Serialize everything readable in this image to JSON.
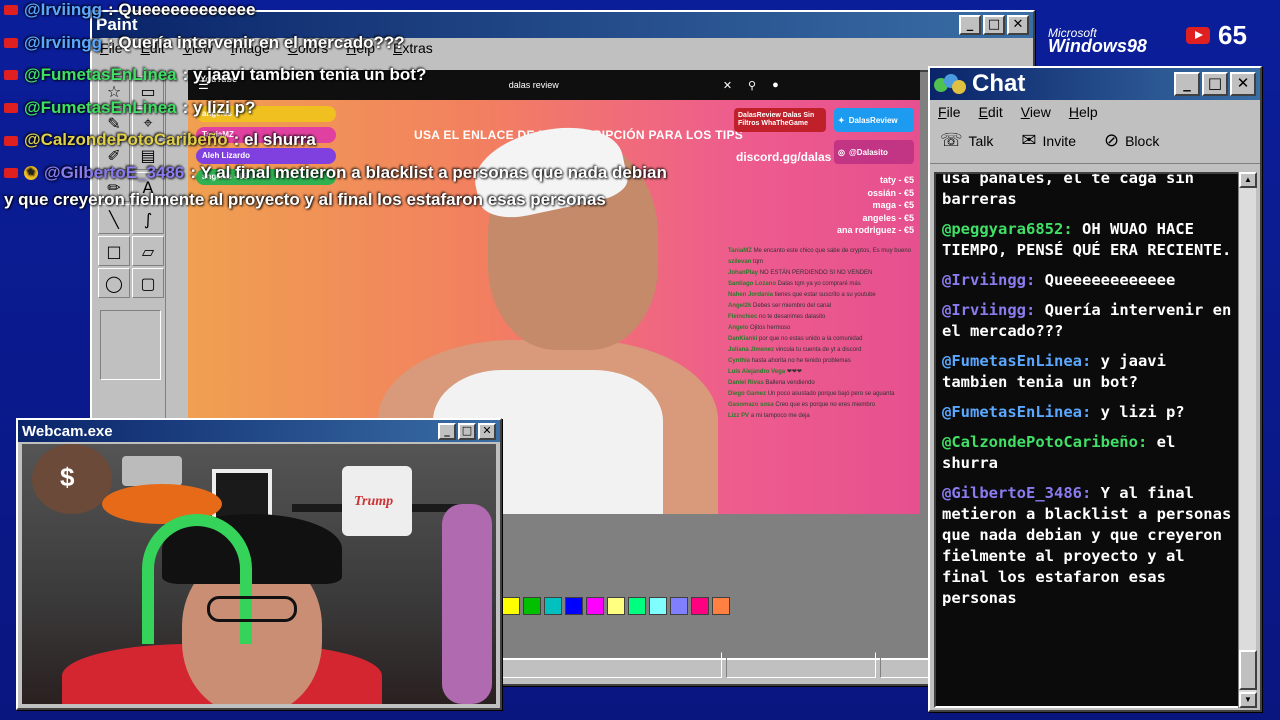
{
  "paint": {
    "title": "Paint",
    "menu": [
      "File",
      "Edit",
      "View",
      "Image",
      "Colors",
      "Help",
      "Extras"
    ],
    "tools": [
      "☆",
      "▭",
      "✎",
      "⌖",
      "✐",
      "▤",
      "✏",
      "A",
      "╲",
      "∫",
      "□",
      "▱",
      "◯",
      "▢"
    ],
    "palette": [
      "#ffff00",
      "#00c000",
      "#00c0c0",
      "#0000ff",
      "#ff00ff",
      "#ffff80",
      "#00ff80",
      "#80ffff",
      "#8080ff",
      "#ff0080",
      "#ff8040"
    ]
  },
  "youtube": {
    "search_text": "dalas review",
    "logo": "YouTube",
    "banner": "USA EL ENLACE DE LA DESCRIPCIÓN PARA LOS TIPS",
    "discord": "discord.gg/dalas",
    "social_youtube": "DalasReview Dalas Sin Filtros WhaTheGame",
    "social_twitter": "DalasReview",
    "social_instagram": "@Dalasito",
    "tips": [
      "taty - €5",
      "ossián - €5",
      "maga - €5",
      "angeles - €5",
      "ana rodriguez - €5"
    ],
    "goals": [
      "angeles",
      "TaniaMZ",
      "Aleh Lizardo",
      "angeles - €5"
    ],
    "mini_chat": [
      {
        "u": "TaniaMZ",
        "t": "Me encanto este chico que sabe de cryptos, Es muy bueno"
      },
      {
        "u": "szilevan",
        "t": "tqm"
      },
      {
        "u": "JohanPlay",
        "t": "NO ESTÁN PERDIENDO SI NO VENDEN"
      },
      {
        "u": "Santiago Lozano",
        "t": "Dalas tqm ya yo compraré más"
      },
      {
        "u": "Nahen Jordania",
        "t": "tienes que estar suscrito a su youtube"
      },
      {
        "u": "Angel2k",
        "t": "Debes ser miembro del canal"
      },
      {
        "u": "Fleinchiec",
        "t": "no te desanimes dalasito"
      },
      {
        "u": "Angelo",
        "t": "Ojitos hermoso"
      },
      {
        "u": "DanKianki",
        "t": "por que no estas unido a la comunidad"
      },
      {
        "u": "Juliana Jimenez",
        "t": "vincula tu cuenta de yt a discord"
      },
      {
        "u": "Cynthia",
        "t": "hasta ahorita no he tenido problemas"
      },
      {
        "u": "Luis Alejandro Vega",
        "t": "❤❤❤"
      },
      {
        "u": "Daniel Rivas",
        "t": "Ballena vendiendo"
      },
      {
        "u": "Diego Gamez",
        "t": "Un poco asustado porque bajó pero se aguanta"
      },
      {
        "u": "Gasomazo sosa",
        "t": "Creo que es porque no eres miembro"
      },
      {
        "u": "Lizz PV",
        "t": "a mi tampoco me deja"
      }
    ]
  },
  "webcam": {
    "title": "Webcam.exe",
    "toilet_paper_label": "Trump"
  },
  "chat": {
    "title": "Chat",
    "menu": [
      "File",
      "Edit",
      "View",
      "Help"
    ],
    "tools": [
      {
        "label": "Talk",
        "icon": "☏"
      },
      {
        "label": "Invite",
        "icon": "✉"
      },
      {
        "label": "Block",
        "icon": "⊘"
      }
    ],
    "messages": [
      {
        "user": "",
        "text": "usa pañales, el te caga sin barreras",
        "color": ""
      },
      {
        "user": "@peggyara6852:",
        "text": " OH WUAO HACE TIEMPO, PENSÉ QUÉ ERA RECIENTE.",
        "color": ""
      },
      {
        "user": "@Irviingg:",
        "text": " Queeeeeeeeeeee",
        "color": "v"
      },
      {
        "user": "@Irviingg:",
        "text": " Quería intervenir en el mercado???",
        "color": "v"
      },
      {
        "user": "@FumetasEnLinea:",
        "text": " y jaavi tambien tenia un bot?",
        "color": "b"
      },
      {
        "user": "@FumetasEnLinea:",
        "text": " y lizi p?",
        "color": "b"
      },
      {
        "user": "@CalzondePotoCaribeño:",
        "text": " el shurra",
        "color": ""
      },
      {
        "user": "@GilbertoE_3486:",
        "text": " Y al final metieron a blacklist a personas que nada debian y que creyeron fielmente al proyecto y al final los estafaron esas personas",
        "color": "v"
      }
    ]
  },
  "branding": {
    "microsoft": "Microsoft",
    "windows": "Windows98",
    "viewers": "65"
  },
  "overlay_chat": [
    {
      "user": "@Irviingg",
      "text": ": Queeeeeeeeeeee",
      "color": "b",
      "star": false
    },
    {
      "user": "@Irviingg",
      "text": ": Quería intervenir en el mercado???",
      "color": "b",
      "star": false
    },
    {
      "user": "@FumetasEnLinea",
      "text": ": y jaavi tambien tenia un bot?",
      "color": "",
      "star": false
    },
    {
      "user": "@FumetasEnLinea",
      "text": ": y lizi p?",
      "color": "",
      "star": false
    },
    {
      "user": "@CalzondePotoCaribeño",
      "text": ": el shurra",
      "color": "y",
      "star": false
    },
    {
      "user": "@GilbertoE_3486",
      "text": ": Y al final metieron a blacklist a personas que nada debian",
      "color": "v",
      "star": true
    }
  ],
  "overlay_cont": "y que creyeron fielmente al proyecto y al final los estafaron esas personas"
}
